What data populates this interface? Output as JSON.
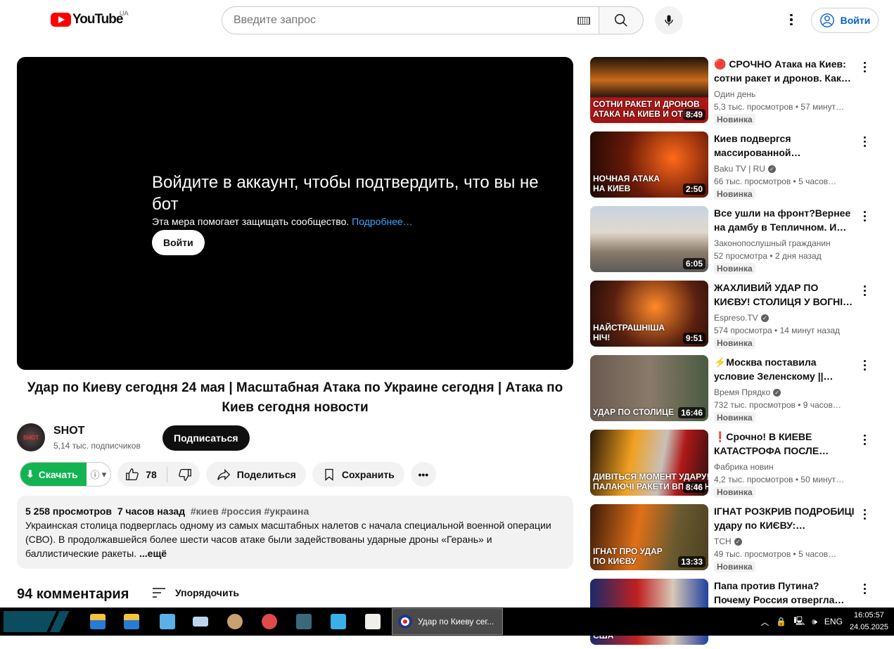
{
  "header": {
    "logo_text": "YouTube",
    "country": "UA",
    "search_placeholder": "Введите запрос",
    "signin_label": "Войти"
  },
  "player": {
    "message": "Войдите в аккаунт, чтобы подтвердить, что вы не бот",
    "sub": "Эта мера помогает защищать сообщество.",
    "learn_more": "Подробнее…",
    "signin_label": "Войти"
  },
  "video": {
    "title": "Удар по Киеву сегодня 24 мая | Масштабная Атака по Украине сегодня | Атака по Киев сегодня новости",
    "channel": "SHOT",
    "avatar_text": "SHOT",
    "subscribers": "5,14 тыс. подписчиков",
    "subscribe_label": "Подписаться",
    "download_label": "Скачать",
    "likes": "78",
    "share_label": "Поделиться",
    "save_label": "Сохранить",
    "views": "5 258 просмотров",
    "age": "7 часов назад",
    "tags": "#киев #россия #украина",
    "description": "Украинская столица подверглась одному из самых масштабных налетов с начала специальной военной операции (СВО). В продолжавшейся более шести часов атаке были задействованы ударные дроны «Герань» и баллистические ракеты.",
    "more_label": "...ещё",
    "comments_count": "94 комментария",
    "sort_label": "Упорядочить"
  },
  "related": [
    {
      "title": "🔴 СРОЧНО Атака на Киев: сотни ракет и дронов. Как…",
      "channel": "Один день",
      "verified": false,
      "stats": "5,3 тыс. просмотров • 57 минут…",
      "badge": "Новинка",
      "duration": "8:49",
      "caption": "СОТНИ РАКЕТ И ДРОНОВ\nАТАКА НА КИЕВ И ОТВЕТ",
      "bg": "linear-gradient(#1a1208 0%,#c86a1a 35%,#2a1a10 60%,#b01818 62%,#a01515 100%)"
    },
    {
      "title": "Киев подвергся массированной воздушной…",
      "channel": "Baku TV | RU",
      "verified": true,
      "stats": "66 тыс. просмотров • 5 часов…",
      "badge": "Новинка",
      "duration": "2:50",
      "caption": "НОЧНАЯ АТАКА\nНА КИЕВ",
      "bg": "radial-gradient(circle at 70% 40%,#ff6a1a,#6a1a08 50%,#1a0804)"
    },
    {
      "title": "Все ушли на фронт?Вернее на дамбу в Тепличном. И тепер…",
      "channel": "Законопослушный гражданин",
      "verified": false,
      "stats": "52 просмотра • 2 дня назад",
      "badge": "Новинка",
      "duration": "6:05",
      "caption": "",
      "bg": "linear-gradient(#c8d4e0 0%,#e0d8cc 40%,#8a7a6a 70%,#5a5a5a)"
    },
    {
      "title": "ЖАХЛИВИЙ УДАР ПО КИЄВУ! СТОЛИЦЯ У ВОГНІ –…",
      "channel": "Espreso.TV",
      "verified": true,
      "stats": "574 просмотра • 14 минут назад",
      "badge": "Новинка",
      "duration": "9:51",
      "caption": "НАЙСТРАШНІША\nНІЧ!",
      "bg": "radial-gradient(circle at 55% 40%,#ff8a2a,#5a2010 55%,#1a0a08)"
    },
    {
      "title": "⚡Москва поставила условие Зеленскому || Атака…",
      "channel": "Время Прядко",
      "verified": true,
      "stats": "732 тыс. просмотров • 9 часов…",
      "badge": "Новинка",
      "duration": "16:46",
      "caption": "УДАР ПО СТОЛИЦЕ",
      "bg": "linear-gradient(90deg,#6a5a50,#8a7a6a 50%,#4a5a40)"
    },
    {
      "title": "❗Срочно! В КИЕВЕ КАТАСТРОФА ПОСЛЕ…",
      "channel": "Фабрика новин",
      "verified": false,
      "stats": "4,2 тыс. просмотров • 50 минут…",
      "badge": "Новинка",
      "duration": "8:46",
      "caption": "ДИВІТЬСЯ МОМЕНТ УДАРУ!\nПАЛАЮЧІ РАКЕТИ ВПАЛИ НА",
      "bg": "linear-gradient(100deg,#2a1808,#f0a020 35%,#c8c0b8 60%,#b01818 75%,#301010)"
    },
    {
      "title": "ІГНАТ РОЗКРИВ ПОДРОБИЦІ удару по КИЄВУ: послухайте,…",
      "channel": "ТСН",
      "verified": true,
      "stats": "49 тыс. просмотров • 5 часов…",
      "badge": "Новинка",
      "duration": "13:33",
      "caption": "ІГНАТ ПРО УДАР\nПО КИЄВУ",
      "bg": "linear-gradient(100deg,#3a1a08,#e07018 40%,#6a5a30 70%,#4a4020)"
    },
    {
      "title": "Папа против Путина? Почему Россия отвергла Ватикан ка…",
      "channel": "",
      "verified": false,
      "stats": "",
      "badge": "",
      "duration": "",
      "caption": "США",
      "bg": "linear-gradient(90deg,#1a2a6a,#c02020 40%,#d8c8b8 70%,#2040a0)"
    }
  ],
  "taskbar": {
    "active_app": "Удар по Киеву сег...",
    "lang": "ENG",
    "time": "16:05:57",
    "date": "24.05.2025"
  }
}
